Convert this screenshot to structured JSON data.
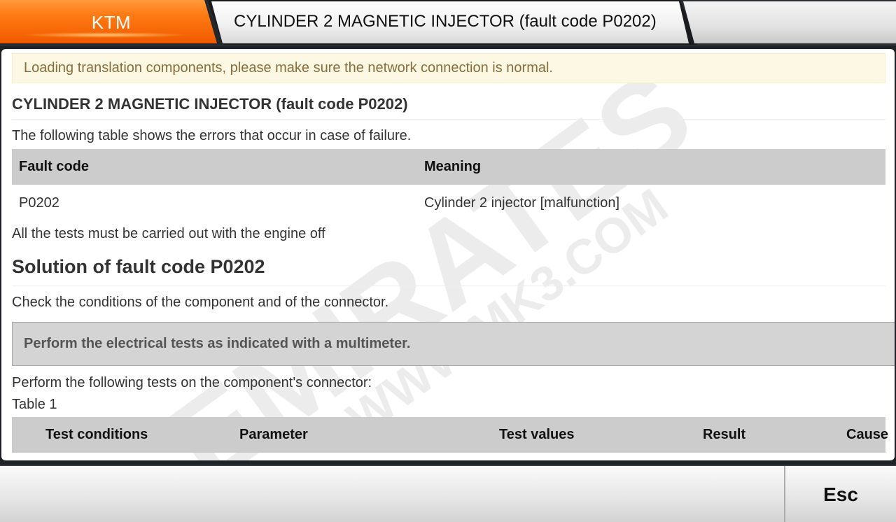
{
  "header": {
    "brand": "KTM",
    "title": "CYLINDER 2 MAGNETIC INJECTOR (fault code P0202)"
  },
  "colors": {
    "brand_orange": "#ff7a12",
    "notice_bg": "#fcf8e3",
    "notice_text": "#8a6d3b",
    "table_header_bg": "#cccccc"
  },
  "watermark": {
    "brand": "EMIRATES",
    "url": "WWW.MK3.COM"
  },
  "content": {
    "notice": "Loading translation components, please make sure the network connection is normal.",
    "section_title": "CYLINDER 2 MAGNETIC INJECTOR (fault code P0202)",
    "intro": "The following table shows the errors that occur in case of failure.",
    "fault_table": {
      "headers": [
        "Fault code",
        "Meaning"
      ],
      "rows": [
        [
          "P0202",
          "Cylinder 2 injector [malfunction]"
        ]
      ]
    },
    "engine_note": "All the tests must be carried out with the engine off",
    "solution_title": "Solution of fault code P0202",
    "check_text": "Check the conditions of the component and of the connector.",
    "callout": "Perform the electrical tests as indicated with a multimeter.",
    "tests_intro": "Perform the following tests on the component's connector:",
    "table_label": "Table 1",
    "test_table": {
      "headers": [
        "Test conditions",
        "Parameter",
        "Test values",
        "Result",
        "Cause"
      ]
    }
  },
  "footer": {
    "esc_label": "Esc"
  }
}
